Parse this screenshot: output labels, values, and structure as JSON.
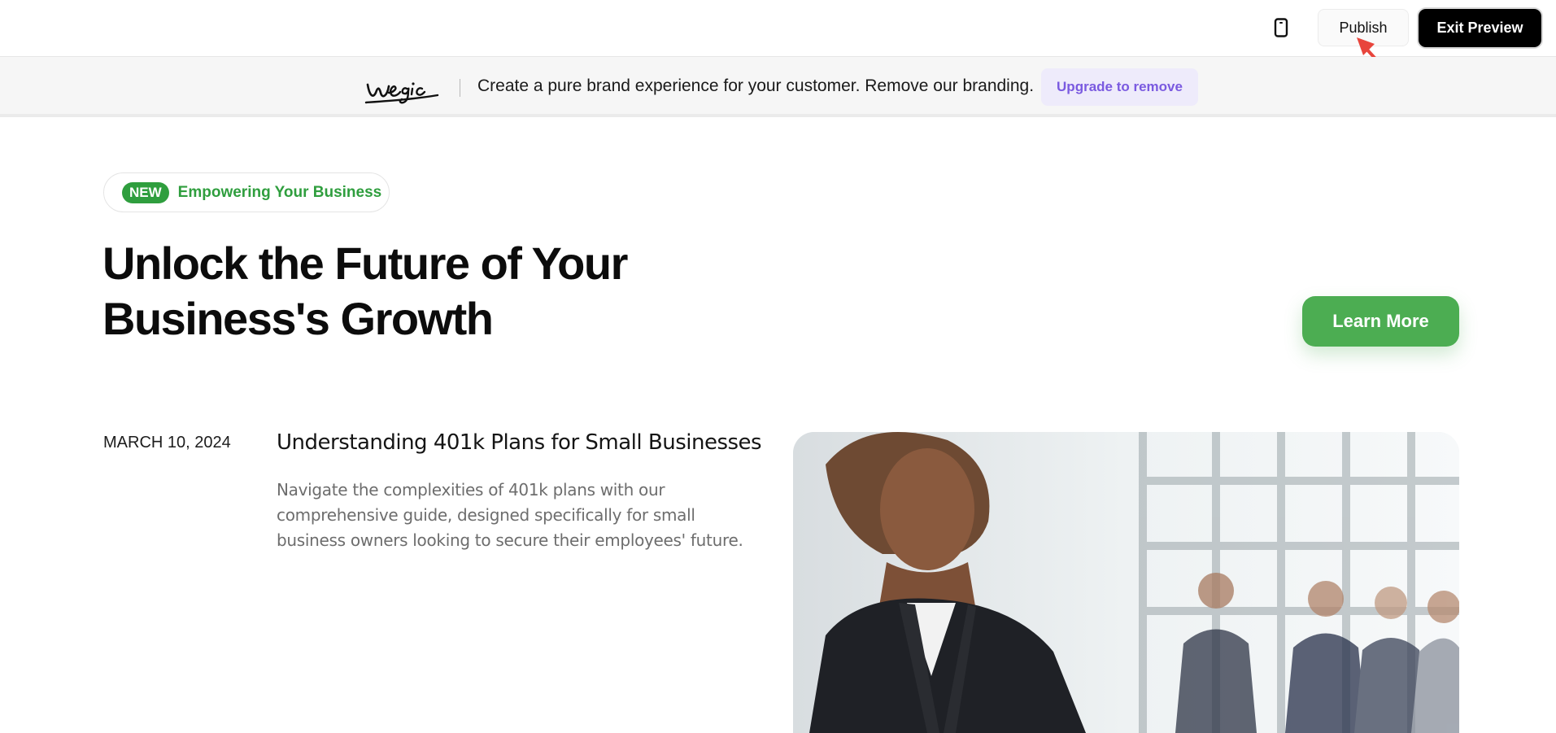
{
  "toolbar": {
    "device_toggle_icon": "mobile-device-icon",
    "publish_label": "Publish",
    "exit_preview_label": "Exit Preview"
  },
  "branding_banner": {
    "logo_text": "wegic",
    "message": "Create a pure brand experience for your customer. Remove our branding.",
    "upgrade_label": "Upgrade to remove"
  },
  "hero": {
    "badge_new": "NEW",
    "badge_text": "Empowering Your Business",
    "title": "Unlock the Future of Your Business's Growth",
    "cta_label": "Learn More"
  },
  "article": {
    "date": "MARCH 10, 2024",
    "title": "Understanding 401k Plans for Small Businesses",
    "excerpt": "Navigate the complexities of 401k plans with our comprehensive guide, designed specifically for small business owners looking to secure their employees' future."
  },
  "colors": {
    "accent_green": "#4cad52",
    "badge_green": "#2f9e3e",
    "upgrade_purple": "#7a5ae0",
    "annotation_red": "#e8453c"
  }
}
